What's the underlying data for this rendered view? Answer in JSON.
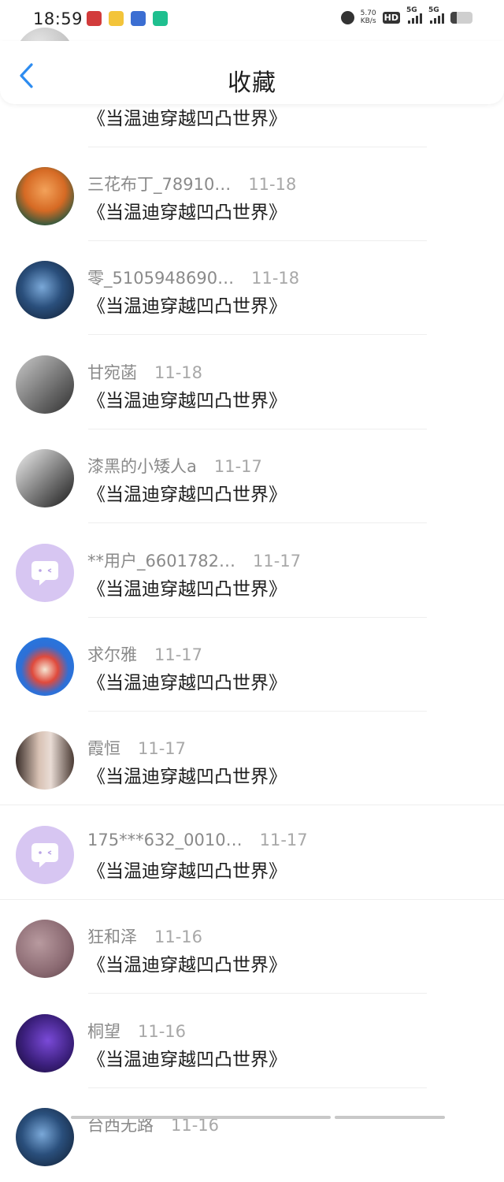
{
  "status_bar": {
    "time": "18:59",
    "net_speed_value": "5.70",
    "net_speed_unit": "KB/s",
    "hd_label": "HD",
    "signal1_label": "5G",
    "signal2_label": "5G"
  },
  "header": {
    "back_icon": "chevron-left-icon",
    "title": "收藏",
    "accent_color": "#2d8cf0"
  },
  "items": [
    {
      "user": "",
      "date": "",
      "title": "《当温迪穿越凹凸世界》",
      "avatar": "gray"
    },
    {
      "user": "三花布丁_78910…",
      "date": "11-18",
      "title": "《当温迪穿越凹凸世界》",
      "avatar": "orange-anime"
    },
    {
      "user": "零_5105948690…",
      "date": "11-18",
      "title": "《当温迪穿越凹凸世界》",
      "avatar": "blue-dark"
    },
    {
      "user": "甘宛菡",
      "date": "11-18",
      "title": "《当温迪穿越凹凸世界》",
      "avatar": "gray-portrait"
    },
    {
      "user": "漆黑的小矮人a",
      "date": "11-17",
      "title": "《当温迪穿越凹凸世界》",
      "avatar": "dark-sketch"
    },
    {
      "user": "**用户_6601782…",
      "date": "11-17",
      "title": "《当温迪穿越凹凸世界》",
      "avatar": "default-purple"
    },
    {
      "user": "求尔雅",
      "date": "11-17",
      "title": "《当温迪穿越凹凸世界》",
      "avatar": "blue-cartoon"
    },
    {
      "user": "霞恒",
      "date": "11-17",
      "title": "《当温迪穿越凹凸世界》",
      "avatar": "photo-girls"
    },
    {
      "user": "175***632_0010…",
      "date": "11-17",
      "title": "《当温迪穿越凹凸世界》",
      "avatar": "default-purple"
    },
    {
      "user": "狂和泽",
      "date": "11-16",
      "title": "《当温迪穿越凹凸世界》",
      "avatar": "dusty-pink"
    },
    {
      "user": "桐望",
      "date": "11-16",
      "title": "《当温迪穿越凹凸世界》",
      "avatar": "purple-night"
    },
    {
      "user": "台西无路",
      "date": "11-16",
      "title": "",
      "avatar": "blue-dark"
    }
  ]
}
